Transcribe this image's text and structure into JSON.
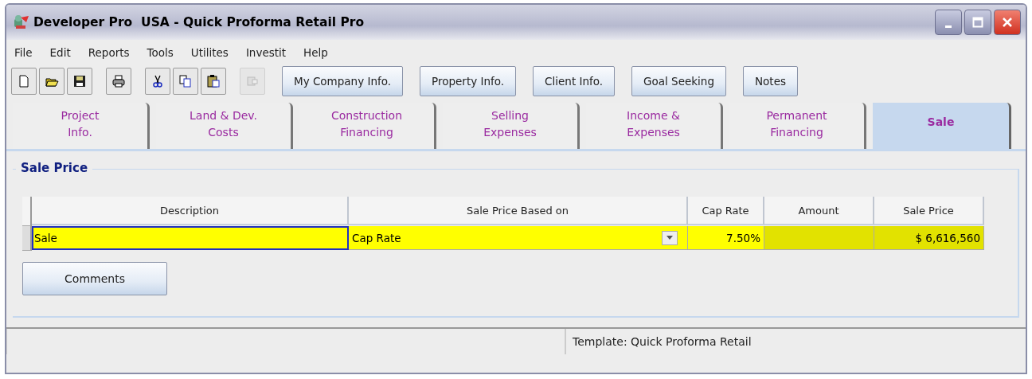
{
  "window": {
    "title": "Developer Pro  USA - Quick Proforma Retail Pro"
  },
  "menu": [
    "File",
    "Edit",
    "Reports",
    "Tools",
    "Utilites",
    "Investit",
    "Help"
  ],
  "toolbar": {
    "icon_buttons": [
      {
        "kind": "new",
        "disabled": false
      },
      {
        "kind": "open",
        "disabled": false
      },
      {
        "kind": "save",
        "disabled": false
      },
      {
        "kind": "print",
        "disabled": false
      },
      {
        "kind": "cut",
        "disabled": false
      },
      {
        "kind": "copy",
        "disabled": false
      },
      {
        "kind": "paste",
        "disabled": false
      },
      {
        "kind": "export",
        "disabled": true
      }
    ],
    "buttons": [
      "My Company Info.",
      "Property Info.",
      "Client Info.",
      "Goal Seeking",
      "Notes"
    ]
  },
  "tabs": [
    {
      "label": "Project\nInfo.",
      "selected": false
    },
    {
      "label": "Land & Dev.\nCosts",
      "selected": false
    },
    {
      "label": "Construction\nFinancing",
      "selected": false
    },
    {
      "label": "Selling\nExpenses",
      "selected": false
    },
    {
      "label": "Income &\nExpenses",
      "selected": false
    },
    {
      "label": "Permanent\nFinancing",
      "selected": false
    },
    {
      "label": "Sale",
      "selected": true
    }
  ],
  "section": {
    "title": "Sale Price"
  },
  "table": {
    "columns": [
      "Description",
      "Sale Price Based on",
      "Cap Rate",
      "Amount",
      "Sale Price"
    ],
    "rows": [
      {
        "cells": [
          {
            "value": "Sale",
            "kind": "text",
            "focused": true,
            "readonly": false
          },
          {
            "value": "Cap Rate",
            "kind": "dropdown",
            "focused": false,
            "readonly": false
          },
          {
            "value": "7.50%",
            "kind": "number",
            "focused": false,
            "readonly": false
          },
          {
            "kind": "number",
            "focused": false,
            "readonly": true
          },
          {
            "value": "$ 6,616,560",
            "kind": "number",
            "focused": false,
            "readonly": true
          }
        ]
      }
    ]
  },
  "comments_button": "Comments",
  "status_bar": {
    "template": "Template: Quick Proforma Retail"
  }
}
